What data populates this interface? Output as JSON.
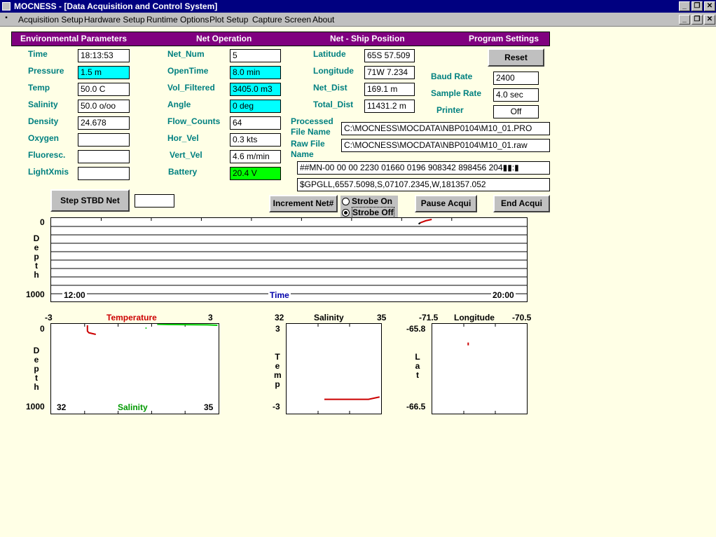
{
  "window": {
    "title": "MOCNESS - [Data Acquisition and Control System]",
    "buttons": [
      "_",
      "❐",
      "✕"
    ]
  },
  "menu": [
    {
      "label": "Acquisition Setup"
    },
    {
      "label": "Hardware Setup"
    },
    {
      "label": "Runtime Options"
    },
    {
      "label": "Plot Setup"
    },
    {
      "label": "Capture Screen"
    },
    {
      "label": "About"
    }
  ],
  "header": {
    "env": "Environmental Parameters",
    "net": "Net Operation",
    "pos": "Net - Ship Position",
    "prog": "Program Settings"
  },
  "env": {
    "time_label": "Time",
    "time": "18:13:53",
    "pressure_label": "Pressure",
    "pressure": "1.5 m",
    "temp_label": "Temp",
    "temp": "50.0 C",
    "salinity_label": "Salinity",
    "salinity": "50.0 o/oo",
    "density_label": "Density",
    "density": "24.678",
    "oxygen_label": "Oxygen",
    "oxygen": "",
    "fluoresc_label": "Fluoresc.",
    "fluoresc": "",
    "lightxmis_label": "LightXmis",
    "lightxmis": ""
  },
  "net": {
    "num_label": "Net_Num",
    "num": "5",
    "opentime_label": "OpenTime",
    "opentime": "8.0 min",
    "vol_label": "Vol_Filtered",
    "vol": "3405.0 m3",
    "angle_label": "Angle",
    "angle": "0 deg",
    "flow_label": "Flow_Counts",
    "flow": "64",
    "horvel_label": "Hor_Vel",
    "horvel": "0.3 kts",
    "vertvel_label": "Vert_Vel",
    "vertvel": "4.6 m/min",
    "battery_label": "Battery",
    "battery": "20.4 V"
  },
  "position": {
    "lat_label": "Latitude",
    "lat": "65S 57.509",
    "lon_label": "Longitude",
    "lon": "71W 7.234",
    "netdist_label": "Net_Dist",
    "netdist": "169.1 m",
    "totaldist_label": "Total_Dist",
    "totaldist": "11431.2 m"
  },
  "settings": {
    "reset_label": "Reset",
    "baud_label": "Baud Rate",
    "baud": "2400",
    "sample_label": "Sample Rate",
    "sample": "4.0 sec",
    "printer_label": "Printer",
    "printer": "Off"
  },
  "files": {
    "processed_label_1": "Processed",
    "processed_label_2": "File Name",
    "processed": "C:\\MOCNESS\\MOCDATA\\NBP0104\\M10_01.PRO",
    "raw_label_1": "Raw File",
    "raw_label_2": "Name",
    "raw": "C:\\MOCNESS\\MOCDATA\\NBP0104\\M10_01.raw",
    "stream1": "##MN-00 00 00 2230 01660 0196 908342 898456 204▮▮:▮",
    "stream2": "$GPGLL,6557.5098,S,07107.2345,W,181357.052"
  },
  "controls": {
    "step_label": "Step STBD Net",
    "step_value": "",
    "increment_label": "Increment Net#",
    "strobe_on": "Strobe On",
    "strobe_off": "Strobe Off",
    "strobe_selected": "off",
    "pause_label": "Pause Acqui",
    "end_label": "End Acqui"
  },
  "colors": {
    "header_bg": "#800080",
    "label": "#008080",
    "cyan_field": "#00ffff",
    "green_field": "#00ff00",
    "temperature": "#cc0000",
    "salinity": "#00cc00",
    "time_label": "#0000aa"
  },
  "chart_data": [
    {
      "type": "line",
      "name": "depth-time",
      "xlabel": "Time",
      "ylabel_letters": [
        "D",
        "e",
        "p",
        "t",
        "h"
      ],
      "x_start": "12:00",
      "x_end": "20:00",
      "ylim": [
        0,
        1000
      ],
      "y_top_label": "0",
      "y_bottom_label": "1000",
      "series": [
        {
          "color": "#000000",
          "points": [
            [
              18.18,
              70
            ],
            [
              18.21,
              50
            ]
          ]
        },
        {
          "color": "#cc0000",
          "points": [
            [
              18.21,
              50
            ],
            [
              18.3,
              20
            ],
            [
              18.4,
              0
            ]
          ]
        }
      ]
    },
    {
      "type": "line",
      "name": "temp-salinity-depth",
      "title": "Temperature",
      "xlabel": "Salinity",
      "ylabel_letters": [
        "D",
        "e",
        "p",
        "t",
        "h"
      ],
      "temp_lim": [
        -3,
        3
      ],
      "sal_lim": [
        32,
        35
      ],
      "ylim": [
        0,
        1000
      ],
      "temp_left": "-3",
      "temp_right": "3",
      "sal_left": "32",
      "sal_right": "35",
      "y_top_label": "0",
      "y_bottom_label": "1000",
      "series": [
        {
          "name": "Temperature",
          "color": "#cc0000",
          "x": [
            -1.7,
            -1.7,
            -1.65,
            -1.4
          ],
          "y": [
            0,
            70,
            90,
            110
          ]
        },
        {
          "name": "Salinity",
          "color": "#00cc00",
          "x": [
            33.9,
            34.1,
            34.4,
            34.8,
            34.98
          ],
          "y": [
            20,
            40,
            60,
            80,
            120
          ]
        }
      ]
    },
    {
      "type": "line",
      "name": "temp-salinity",
      "title": "Salinity",
      "ylabel_letters": [
        "T",
        "e",
        "m",
        "p"
      ],
      "xlim": [
        32,
        35
      ],
      "ylim": [
        -3,
        3
      ],
      "x_left": "32",
      "x_right": "35",
      "y_top_label": "3",
      "y_bottom_label": "-3",
      "series": [
        {
          "color": "#cc0000",
          "x": [
            33.2,
            34.6,
            34.95
          ],
          "y": [
            -2.37,
            -2.37,
            -2.2
          ]
        }
      ]
    },
    {
      "type": "scatter",
      "name": "lat-lon",
      "title": "Longitude",
      "ylabel_letters": [
        "L",
        "a",
        "t"
      ],
      "xlim": [
        -71.5,
        -70.5
      ],
      "ylim": [
        -66.5,
        -65.8
      ],
      "x_left": "-71.5",
      "x_right": "-70.5",
      "y_top_label": "-65.8",
      "y_bottom_label": "-66.5",
      "series": [
        {
          "color": "#cc0000",
          "x": [
            -71.12
          ],
          "y": [
            -65.958
          ]
        }
      ]
    }
  ]
}
